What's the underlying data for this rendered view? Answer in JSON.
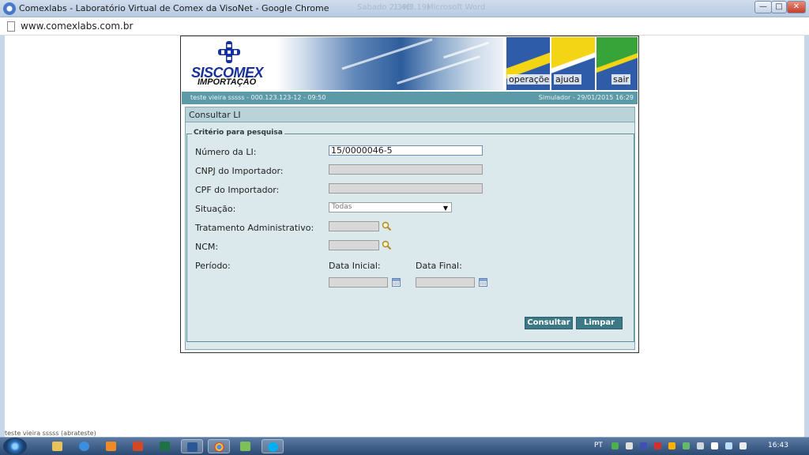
{
  "window": {
    "title": "Comexlabs - Laboratório Virtual de Comex da VisoNet - Google Chrome",
    "ghost_tabs": [
      "Sabado 2/398",
      "1,4(3.19)",
      "Microsoft Word"
    ],
    "minimize": "—",
    "maximize": "□",
    "close": "✕"
  },
  "address": {
    "url": "www.comexlabs.com.br"
  },
  "banner": {
    "logo_title": "SISCOMEX",
    "logo_subtitle": "IMPORTAÇÃO",
    "menu": [
      "operações",
      "ajuda",
      "sair"
    ]
  },
  "userbar": {
    "user": "teste vieira sssss - 000.123.123-12 - 09:50",
    "env": "Simulador - 29/01/2015 16:29"
  },
  "panel": {
    "title": "Consultar LI",
    "legend": "Critério para pesquisa",
    "fields": {
      "numero_label": "Número da LI:",
      "numero_value": "15/0000046-5",
      "cnpj_label": "CNPJ do Importador:",
      "cpf_label": "CPF do Importador:",
      "situacao_label": "Situação:",
      "situacao_value": "Todas",
      "tratamento_label": "Tratamento Administrativo:",
      "ncm_label": "NCM:",
      "periodo_label": "Período:",
      "data_inicial_label": "Data Inicial:",
      "data_final_label": "Data Final:"
    },
    "buttons": {
      "consultar": "Consultar",
      "limpar": "Limpar"
    }
  },
  "status": "teste vieira sssss (abrateste)",
  "taskbar": {
    "lang": "PT",
    "time": "16:43",
    "accent": "#2b4a73"
  },
  "colors": {
    "panel_bg": "#dbe9ec",
    "userbar": "#5d9aa8",
    "button": "#3d7886",
    "logo": "#17319a"
  }
}
